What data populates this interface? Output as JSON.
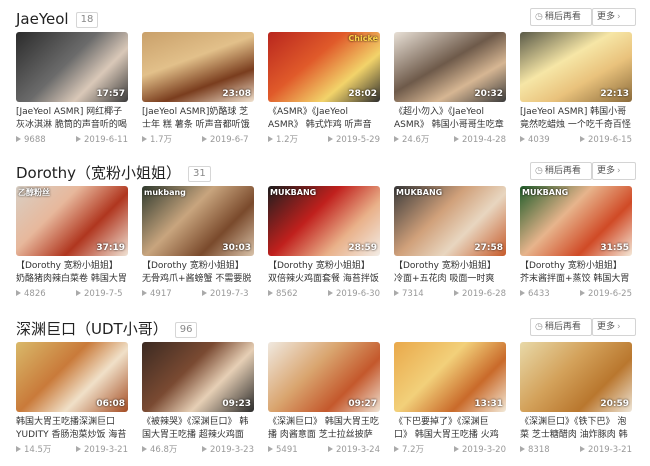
{
  "sections": [
    {
      "title": "JaeYeol",
      "count": "18",
      "watch_later": "稍后再看",
      "more": "更多",
      "videos": [
        {
          "title": "[JaeYeol ASMR] 网红椰子灰冰淇淋 脆筒的声音听的喝口水",
          "duration": "17:57",
          "plays": "9688",
          "date": "2019-6-11",
          "tag": ""
        },
        {
          "title": "[JaeYeol ASMR]奶酪球 芝士年 糕 薯条 听声音都听饿了",
          "duration": "23:08",
          "plays": "1.7万",
          "date": "2019-6-7",
          "tag": ""
        },
        {
          "title": "《ASMR》《JaeYeol ASMR》 韩式炸鸡 听声音都",
          "duration": "28:02",
          "plays": "1.2万",
          "date": "2019-5-29",
          "tag": "Chicke"
        },
        {
          "title": "《超小勿入》《JaeYeol ASMR》 韩国小哥哥生吃章",
          "duration": "20:32",
          "plays": "24.6万",
          "date": "2019-4-28",
          "tag": ""
        },
        {
          "title": "[JaeYeol ASMR] 韩国小哥竟然吃蜡烛 一个吃千奇百怪的食物",
          "duration": "22:13",
          "plays": "4039",
          "date": "2019-6-15",
          "tag": ""
        }
      ]
    },
    {
      "title": "Dorothy（宽粉小姐姐）",
      "count": "31",
      "watch_later": "稍后再看",
      "more": "更多",
      "videos": [
        {
          "title": "【Dorothy 宽粉小姐姐】 奶酪猪肉辣白菜卷 韩国大胃王吃",
          "duration": "37:19",
          "plays": "4826",
          "date": "2019-7-5",
          "tag": "乙醇粉丝"
        },
        {
          "title": "【Dorothy 宽粉小姐姐】 无骨鸡爪+酱螃蟹 不需要脱骨的",
          "duration": "30:03",
          "plays": "4917",
          "date": "2019-7-3",
          "tag": "mukbang"
        },
        {
          "title": "【Dorothy 宽粉小姐姐】 双倍辣火鸡面套餐 海苔拌饭 看着",
          "duration": "28:59",
          "plays": "8562",
          "date": "2019-6-30",
          "tag": "MUKBANG"
        },
        {
          "title": "【Dorothy 宽粉小姐姐】 冷面+五花肉 吸面一时爽 一直吸面",
          "duration": "27:58",
          "plays": "7314",
          "date": "2019-6-28",
          "tag": "MUKBANG"
        },
        {
          "title": "【Dorothy 宽粉小姐姐】 芥末酱拌面+蒸饺 韩国大胃王吃",
          "duration": "31:55",
          "plays": "6433",
          "date": "2019-6-25",
          "tag": "MUKBANG"
        }
      ]
    },
    {
      "title": "深渊巨口（UDT小哥）",
      "count": "96",
      "watch_later": "稍后再看",
      "more": "更多",
      "videos": [
        {
          "title": "韩国大胃王吃播深渊巨口 YUDITY 香肠泡菜炒饭 海苔",
          "duration": "06:08",
          "plays": "14.5万",
          "date": "2019-3-21",
          "tag": ""
        },
        {
          "title": "《被辣哭》《深渊巨口》 韩国大胃王吃播 超辣火鸡面 方块",
          "duration": "09:23",
          "plays": "46.8万",
          "date": "2019-3-23",
          "tag": ""
        },
        {
          "title": "《深渊巨口》 韩国大胃王吃播 肉酱意面 芝士拉丝披萨 酸黄",
          "duration": "09:27",
          "plays": "5491",
          "date": "2019-3-24",
          "tag": ""
        },
        {
          "title": "《下巴要掉了》《深渊巨口》 韩国大胃王吃播 火鸡面 超脆",
          "duration": "13:31",
          "plays": "7.2万",
          "date": "2019-3-20",
          "tag": ""
        },
        {
          "title": "《深渊巨口》《铁下巴》 泡菜 芝士糖醋肉 油炸豚肉 韩国大",
          "duration": "20:59",
          "plays": "8318",
          "date": "2019-3-21",
          "tag": ""
        }
      ]
    }
  ]
}
